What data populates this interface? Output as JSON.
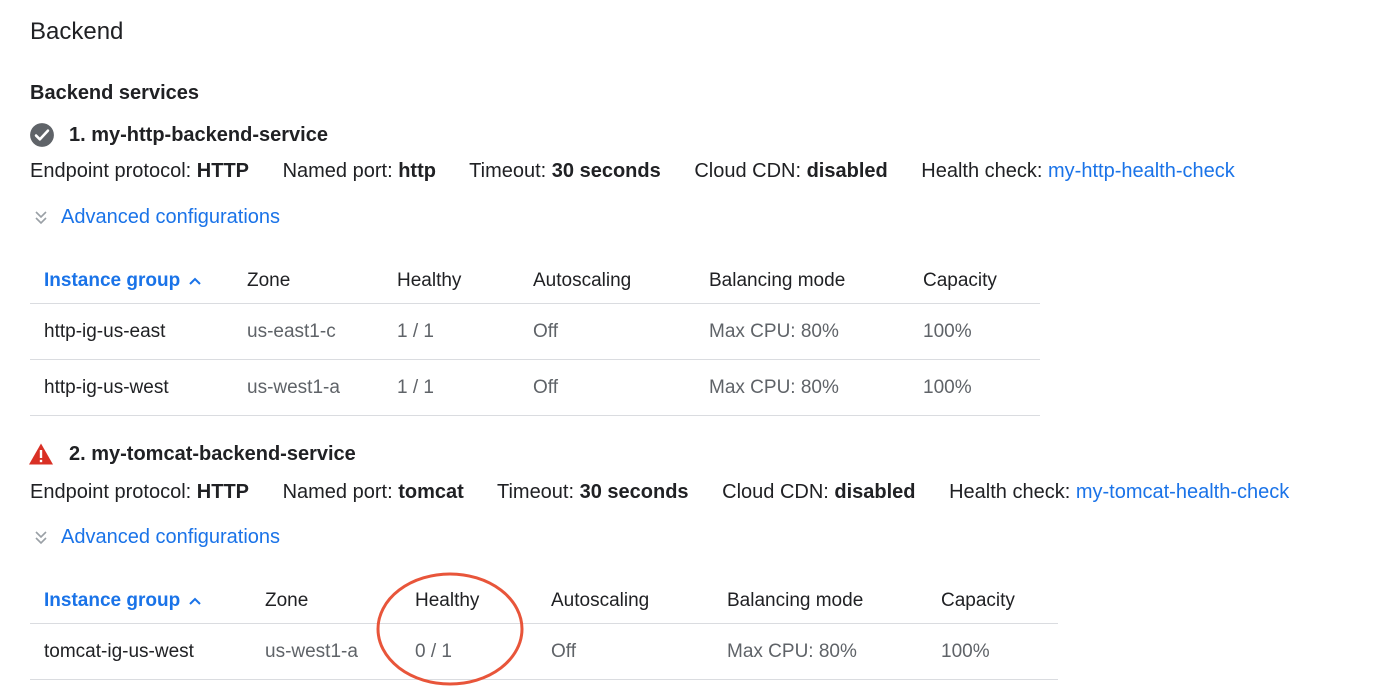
{
  "section_title": "Backend",
  "subsection_title": "Backend services",
  "services": [
    {
      "title": "1. my-http-backend-service",
      "status_icon": "check-circle-icon",
      "labels": {
        "protocol": "Endpoint protocol:",
        "port": "Named port:",
        "timeout": "Timeout:",
        "cdn": "Cloud CDN:",
        "health": "Health check:"
      },
      "values": {
        "protocol": "HTTP",
        "port": "http",
        "timeout": "30 seconds",
        "cdn": "disabled",
        "health": "my-http-health-check"
      },
      "advanced": "Advanced configurations",
      "table": {
        "headers": [
          "Instance group",
          "Zone",
          "Healthy",
          "Autoscaling",
          "Balancing mode",
          "Capacity"
        ],
        "rows": [
          [
            "http-ig-us-east",
            "us-east1-c",
            "1 / 1",
            "Off",
            "Max CPU: 80%",
            "100%"
          ],
          [
            "http-ig-us-west",
            "us-west1-a",
            "1 / 1",
            "Off",
            "Max CPU: 80%",
            "100%"
          ]
        ]
      }
    },
    {
      "title": "2. my-tomcat-backend-service",
      "status_icon": "warning-triangle-icon",
      "labels": {
        "protocol": "Endpoint protocol:",
        "port": "Named port:",
        "timeout": "Timeout:",
        "cdn": "Cloud CDN:",
        "health": "Health check:"
      },
      "values": {
        "protocol": "HTTP",
        "port": "tomcat",
        "timeout": "30 seconds",
        "cdn": "disabled",
        "health": "my-tomcat-health-check"
      },
      "advanced": "Advanced configurations",
      "table": {
        "headers": [
          "Instance group",
          "Zone",
          "Healthy",
          "Autoscaling",
          "Balancing mode",
          "Capacity"
        ],
        "rows": [
          [
            "tomcat-ig-us-west",
            "us-west1-a",
            "0 / 1",
            "Off",
            "Max CPU: 80%",
            "100%"
          ]
        ]
      }
    }
  ],
  "colors": {
    "link": "#1a73e8",
    "check_icon": "#5f6368",
    "warning_icon": "#d93025",
    "annotation_circle": "#e8553a"
  }
}
